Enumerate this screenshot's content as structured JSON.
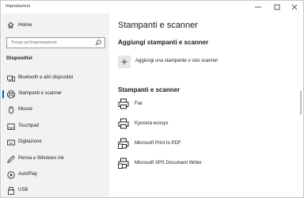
{
  "window": {
    "title": "Impostazioni",
    "controls": {
      "minimize": "minimize-icon",
      "maximize": "maximize-icon",
      "close": "close-icon"
    }
  },
  "sidebar": {
    "home": {
      "label": "Home",
      "icon": "home-icon"
    },
    "search": {
      "placeholder": "Trova un'impostazione",
      "icon": "search-icon"
    },
    "section_title": "Dispositivi",
    "items": [
      {
        "label": "Bluetooth e altri dispositivi",
        "icon": "bluetooth-devices-icon",
        "selected": false
      },
      {
        "label": "Stampanti e scanner",
        "icon": "printer-icon",
        "selected": true
      },
      {
        "label": "Mouse",
        "icon": "mouse-icon",
        "selected": false
      },
      {
        "label": "Touchpad",
        "icon": "touchpad-icon",
        "selected": false
      },
      {
        "label": "Digitazione",
        "icon": "keyboard-icon",
        "selected": false
      },
      {
        "label": "Penna e Windows Ink",
        "icon": "pen-icon",
        "selected": false
      },
      {
        "label": "AutoPlay",
        "icon": "autoplay-icon",
        "selected": false
      },
      {
        "label": "USB",
        "icon": "usb-icon",
        "selected": false
      }
    ]
  },
  "main": {
    "title": "Stampanti e scanner",
    "add_section": {
      "title": "Aggiungi stampanti e scanner",
      "add_label": "Aggiungi una stampante o uno scanner",
      "add_icon": "plus-icon"
    },
    "printers_section": {
      "title": "Stampanti e scanner",
      "printers": [
        {
          "name": "Fax",
          "icon": "fax-printer-icon"
        },
        {
          "name": "Kyocera ecosys",
          "icon": "printer-icon"
        },
        {
          "name": "Microsoft Print to PDF",
          "icon": "pdf-printer-icon"
        },
        {
          "name": "Microsoft XPS Document Writer",
          "icon": "xps-printer-icon"
        }
      ]
    }
  },
  "colors": {
    "accent": "#0063b1",
    "sidebar_bg": "#f2f2f2",
    "text": "#1a1a1a"
  }
}
